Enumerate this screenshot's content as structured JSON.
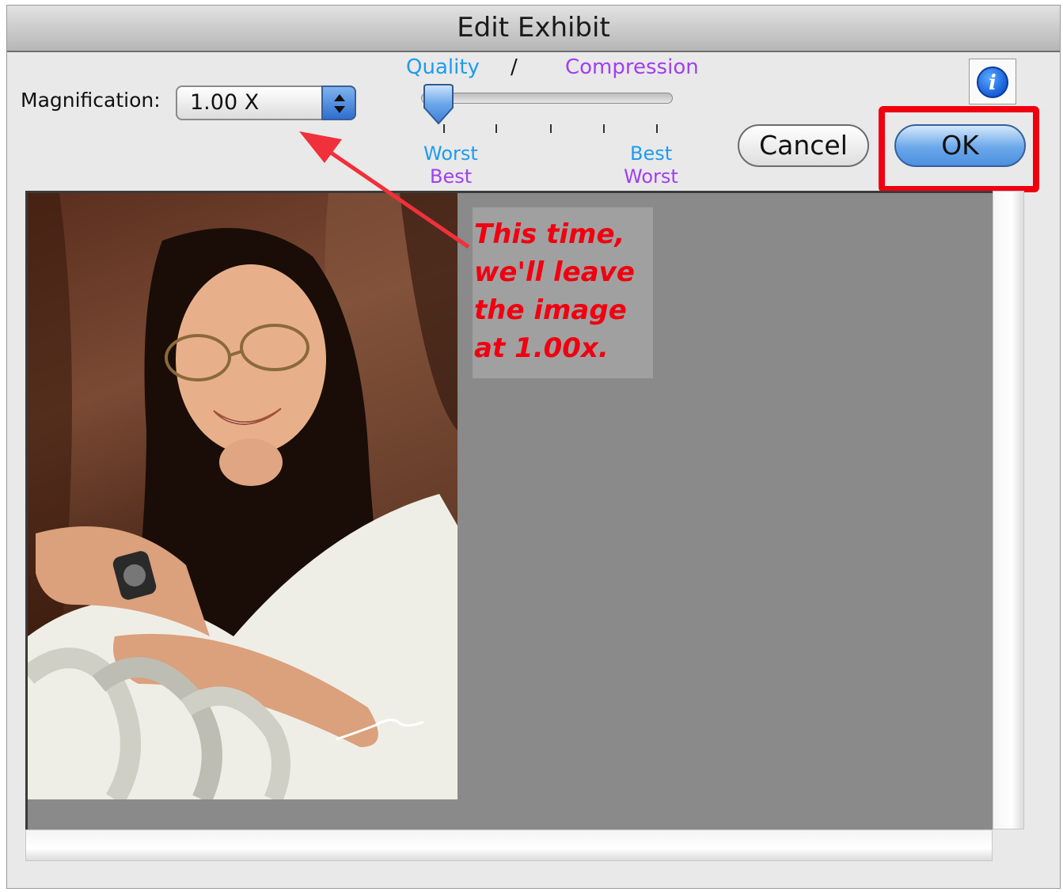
{
  "dialog": {
    "title": "Edit Exhibit"
  },
  "magnification": {
    "label": "Magnification:",
    "value": "1.00 X"
  },
  "slider": {
    "quality_label": "Quality",
    "separator": "/",
    "compression_label": "Compression",
    "left_quality": "Worst",
    "left_compression": "Best",
    "right_quality": "Best",
    "right_compression": "Worst",
    "position": 0,
    "tick_count": 5
  },
  "buttons": {
    "cancel": "Cancel",
    "ok": "OK"
  },
  "annotation": {
    "lines": [
      "This time,",
      "we'll leave",
      "the image",
      "at 1.00x."
    ]
  },
  "colors": {
    "quality": "#1e9cf0",
    "compression": "#a040f0",
    "annotation": "#f00010",
    "highlight": "#f0000f",
    "canvas_bg": "#8a8a8a"
  },
  "icons": {
    "info": "info-icon",
    "stepper": "up-down-arrows-icon",
    "slider_thumb": "slider-thumb-icon"
  }
}
